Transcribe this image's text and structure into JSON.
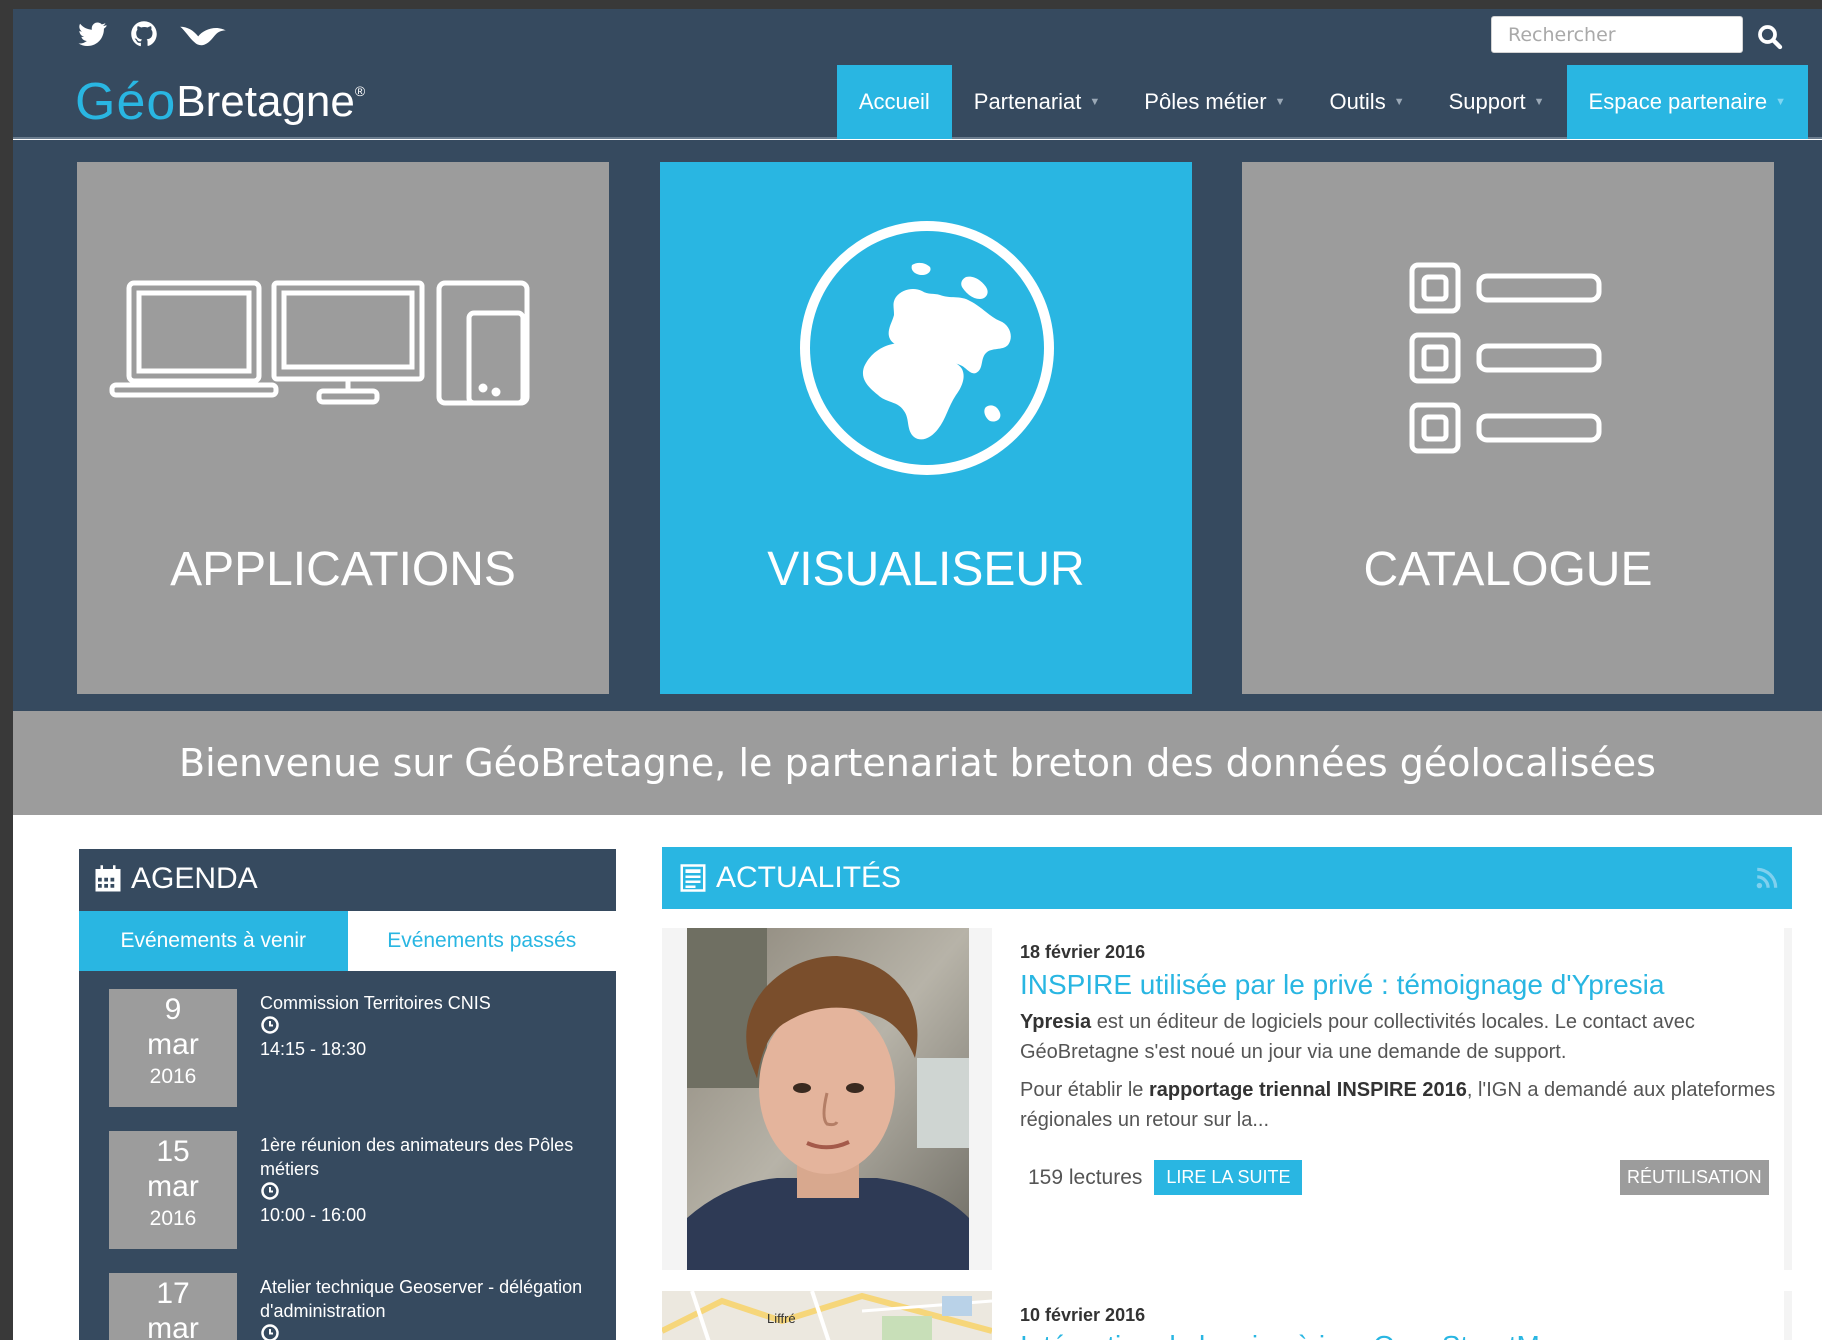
{
  "social": {
    "icons": [
      "twitter-icon",
      "github-icon",
      "bird-icon"
    ]
  },
  "search": {
    "placeholder": "Rechercher",
    "icon": "search-icon"
  },
  "logo": {
    "geo": "Géo",
    "bretagne": "Bretagne",
    "reg": "®"
  },
  "nav": {
    "items": [
      {
        "label": "Accueil",
        "active": true,
        "dropdown": false
      },
      {
        "label": "Partenariat",
        "active": false,
        "dropdown": true
      },
      {
        "label": "Pôles métier",
        "active": false,
        "dropdown": true
      },
      {
        "label": "Outils",
        "active": false,
        "dropdown": true
      },
      {
        "label": "Support",
        "active": false,
        "dropdown": true
      },
      {
        "label": "Espace partenaire",
        "active": false,
        "dropdown": true
      }
    ],
    "caret": "▼"
  },
  "tiles": [
    {
      "label": "APPLICATIONS",
      "icon": "devices-icon"
    },
    {
      "label": "VISUALISEUR",
      "icon": "globe-icon"
    },
    {
      "label": "CATALOGUE",
      "icon": "list-icon"
    }
  ],
  "welcome": "Bienvenue sur GéoBretagne, le partenariat breton des données géolocalisées",
  "agenda": {
    "title": "AGENDA",
    "tabs": [
      "Evénements à venir",
      "Evénements passés"
    ],
    "events": [
      {
        "day": "9",
        "month": "mar",
        "year": "2016",
        "title": "Commission Territoires CNIS",
        "time": "14:15 - 18:30"
      },
      {
        "day": "15",
        "month": "mar",
        "year": "2016",
        "title": "1ère réunion des animateurs des Pôles métiers",
        "time": "10:00 - 16:00"
      },
      {
        "day": "17",
        "month": "mar",
        "year": "",
        "title": "Atelier technique Geoserver - délégation d'administration",
        "time": ""
      }
    ]
  },
  "news": {
    "title": "ACTUALITÉS",
    "articles": [
      {
        "date": "18 février 2016",
        "title": "INSPIRE utilisée par le privé : témoignage d'Ypresia",
        "p1_bold": "Ypresia",
        "p1_rest": " est un éditeur de logiciels pour collectivités locales. Le contact avec GéoBretagne s'est noué un jour via une demande de support.",
        "p2_pre": "Pour établir le ",
        "p2_bold": "rapportage triennal INSPIRE 2016",
        "p2_rest": ", l'IGN a demandé aux plateformes régionales un retour sur la...",
        "reads": "159 lectures",
        "read_more": "LIRE LA SUITE",
        "tag": "RÉUTILISATION"
      },
      {
        "date": "10 février 2016",
        "title": "Intégration de la mise à jour OpenStreetMap",
        "map_label": "Liffré"
      }
    ]
  },
  "colors": {
    "navy": "#364a5f",
    "accent": "#29b6e2",
    "grey": "#9c9c9c"
  }
}
